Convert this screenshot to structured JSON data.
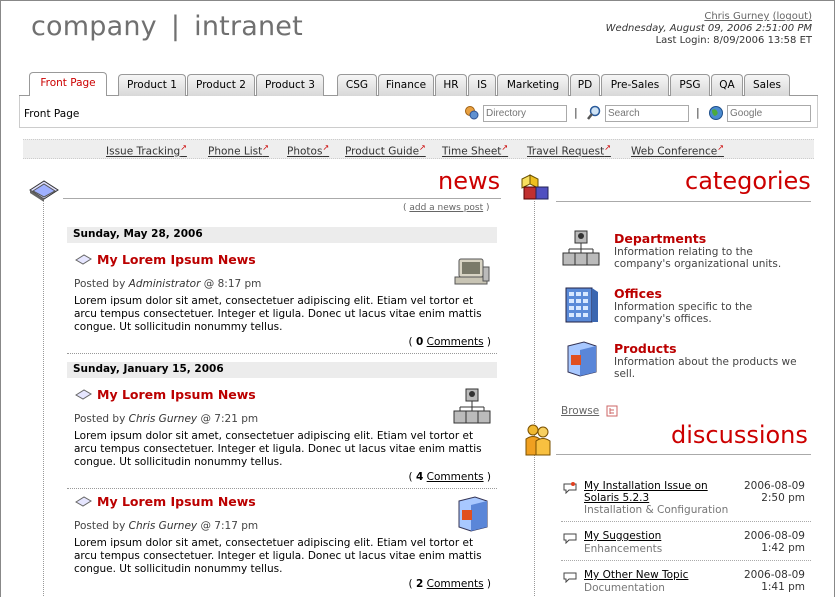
{
  "header": {
    "brand_left": "company",
    "brand_sep": "|",
    "brand_right": "intranet",
    "user_name": "Chris Gurney",
    "logout": "(logout)",
    "datetime": "Wednesday, August 09, 2006 2:51:00 PM",
    "last_login": "Last Login: 8/09/2006 13:58 ET"
  },
  "tabs": [
    "Front Page",
    "Product 1",
    "Product 2",
    "Product 3",
    "CSG",
    "Finance",
    "HR",
    "IS",
    "Marketing",
    "PD",
    "Pre-Sales",
    "PSG",
    "QA",
    "Sales"
  ],
  "breadcrumb": "Front Page",
  "search": {
    "directory_placeholder": "Directory",
    "search_placeholder": "Search",
    "google_placeholder": "Google",
    "pipe": "|"
  },
  "quicklinks": [
    "Issue Tracking",
    "Phone List",
    "Photos",
    "Product Guide",
    "Time Sheet",
    "Travel Request",
    "Web Conference"
  ],
  "news": {
    "title": "news",
    "add_link": "add a news post",
    "days": [
      {
        "date": "Sunday, May 28, 2006",
        "items": [
          {
            "title": "My Lorem Ipsum News",
            "author": "Administrator",
            "time": "@ 8:17 pm",
            "body": "Lorem ipsum dolor sit amet, consectetuer adipiscing elit. Etiam vel tortor et arcu tempus consectetuer. Integer et ligula. Donec ut lacus vitae enim mattis congue. Ut sollicitudin nonummy tellus.",
            "comment_count": "0",
            "comment_label": "Comments"
          }
        ]
      },
      {
        "date": "Sunday, January 15, 2006",
        "items": [
          {
            "title": "My Lorem Ipsum News",
            "author": "Chris Gurney",
            "time": "@ 7:21 pm",
            "body": "Lorem ipsum dolor sit amet, consectetuer adipiscing elit. Etiam vel tortor et arcu tempus consectetuer. Integer et ligula. Donec ut lacus vitae enim mattis congue. Ut sollicitudin nonummy tellus.",
            "comment_count": "4",
            "comment_label": "Comments"
          },
          {
            "title": "My Lorem Ipsum News",
            "author": "Chris Gurney",
            "time": "@ 7:17 pm",
            "body": "Lorem ipsum dolor sit amet, consectetuer adipiscing elit. Etiam vel tortor et arcu tempus consectetuer. Integer et ligula. Donec ut lacus vitae enim mattis congue. Ut sollicitudin nonummy tellus.",
            "comment_count": "2",
            "comment_label": "Comments"
          }
        ]
      }
    ],
    "posted_by": "Posted by"
  },
  "categories": {
    "title": "categories",
    "items": [
      {
        "name": "Departments",
        "desc": "Information relating to the company's organizational units."
      },
      {
        "name": "Offices",
        "desc": "Information specific to the company's offices."
      },
      {
        "name": "Products",
        "desc": "Information about the products we sell."
      }
    ],
    "browse": "Browse"
  },
  "discussions": {
    "title": "discussions",
    "items": [
      {
        "title": "My Installation Issue on Solaris 5.2.3",
        "category": "Installation & Configuration",
        "date": "2006-08-09",
        "time": "2:50 pm"
      },
      {
        "title": "My Suggestion",
        "category": "Enhancements",
        "date": "2006-08-09",
        "time": "1:42 pm"
      },
      {
        "title": "My Other New Topic",
        "category": "Documentation",
        "date": "2006-08-09",
        "time": "1:41 pm"
      }
    ]
  },
  "colors": {
    "accent": "#cc0000",
    "link": "#666666"
  }
}
